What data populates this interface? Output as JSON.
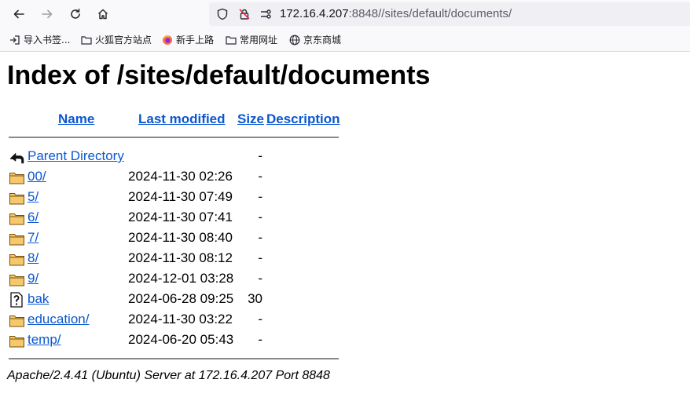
{
  "browser": {
    "url_host": "172.16.4.207",
    "url_rest": ":8848//sites/default/documents/",
    "icons": {
      "back": "back-arrow-icon",
      "forward": "forward-arrow-icon",
      "reload": "reload-icon",
      "home": "home-icon",
      "shield": "shield-icon",
      "insecure": "insecure-lock-icon",
      "permissions": "permissions-icon"
    },
    "bookmarks": [
      {
        "label": "导入书签...",
        "icon": "import-icon"
      },
      {
        "label": "火狐官方站点",
        "icon": "folder-icon"
      },
      {
        "label": "新手上路",
        "icon": "firefox-icon"
      },
      {
        "label": "常用网址",
        "icon": "folder-icon"
      },
      {
        "label": "京东商城",
        "icon": "globe-icon"
      }
    ]
  },
  "page": {
    "title": "Index of /sites/default/documents",
    "columns": {
      "name": "Name",
      "last_modified": "Last modified",
      "size": "Size",
      "description": "Description"
    },
    "rows": [
      {
        "name": "Parent Directory",
        "date": "",
        "size": "-",
        "icon": "back-icon"
      },
      {
        "name": "00/",
        "date": "2024-11-30 02:26",
        "size": "-",
        "icon": "folder-icon"
      },
      {
        "name": "5/",
        "date": "2024-11-30 07:49",
        "size": "-",
        "icon": "folder-icon"
      },
      {
        "name": "6/",
        "date": "2024-11-30 07:41",
        "size": "-",
        "icon": "folder-icon"
      },
      {
        "name": "7/",
        "date": "2024-11-30 08:40",
        "size": "-",
        "icon": "folder-icon"
      },
      {
        "name": "8/",
        "date": "2024-11-30 08:12",
        "size": "-",
        "icon": "folder-icon"
      },
      {
        "name": "9/",
        "date": "2024-12-01 03:28",
        "size": "-",
        "icon": "folder-icon"
      },
      {
        "name": "bak",
        "date": "2024-06-28 09:25",
        "size": "30",
        "icon": "unknown-file-icon"
      },
      {
        "name": "education/",
        "date": "2024-11-30 03:22",
        "size": "-",
        "icon": "folder-icon"
      },
      {
        "name": "temp/",
        "date": "2024-06-20 05:43",
        "size": "-",
        "icon": "folder-icon"
      }
    ],
    "footer": "Apache/2.4.41 (Ubuntu) Server at 172.16.4.207 Port 8848"
  },
  "colors": {
    "link": "#0b57d0",
    "rule": "#888888",
    "chrome": "#f9f9fb",
    "urlbar": "#f0f0f4"
  }
}
